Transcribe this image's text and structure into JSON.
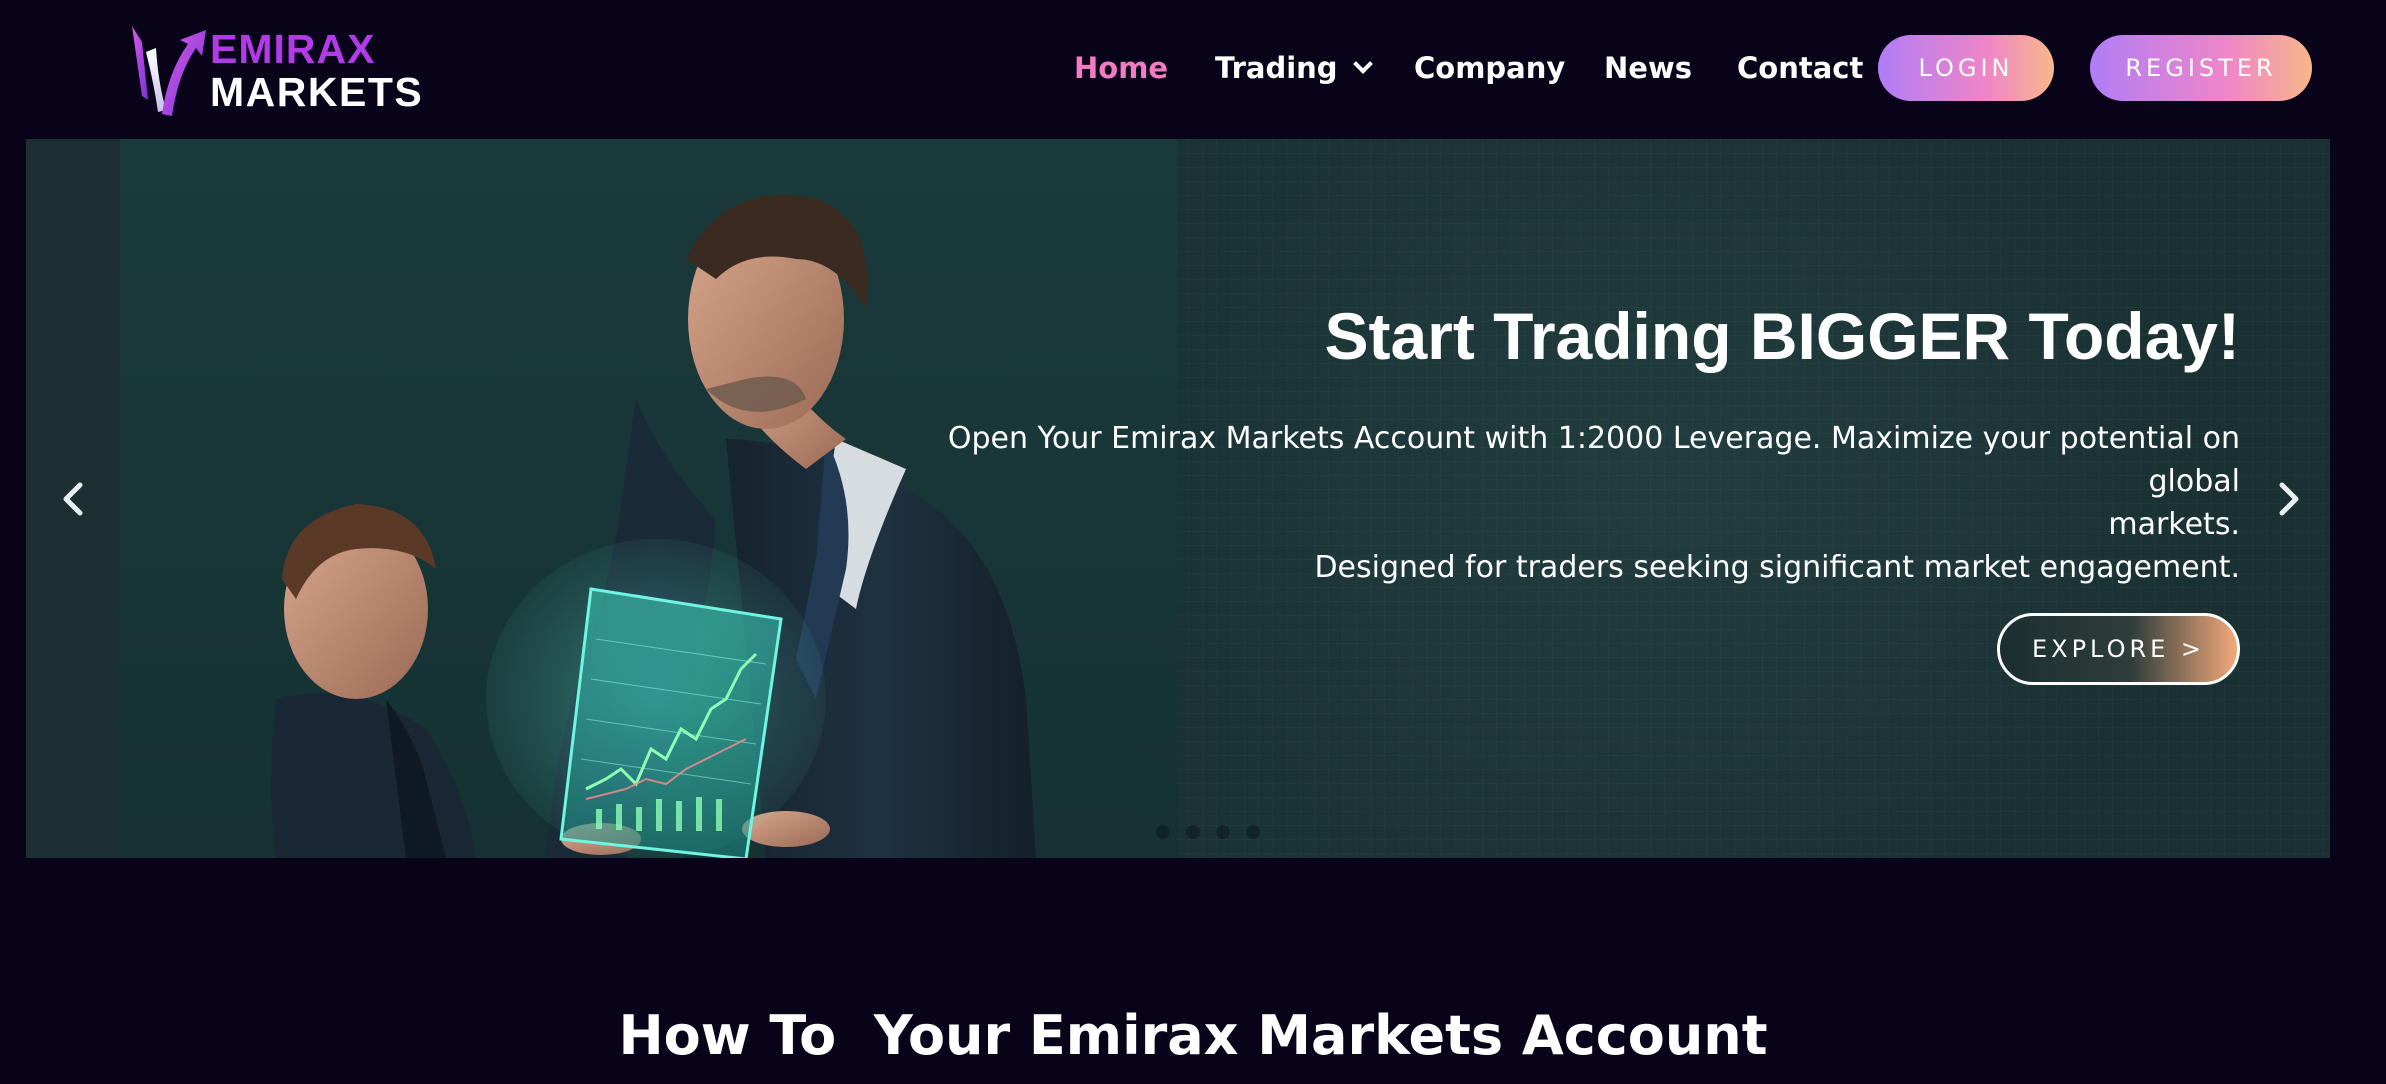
{
  "header": {
    "logo": {
      "line1": "EMIRAX",
      "line2": "MARKETS"
    },
    "nav": [
      {
        "label": "Home",
        "active": true
      },
      {
        "label": "Trading",
        "has_dropdown": true
      },
      {
        "label": "Company"
      },
      {
        "label": "News"
      },
      {
        "label": "Contact"
      }
    ],
    "login_label": "LOGIN",
    "register_label": "REGISTER"
  },
  "hero": {
    "title": "Start Trading BIGGER Today!",
    "subtitle_line1": "Open Your Emirax Markets Account with 1:2000 Leverage. Maximize your potential on global",
    "subtitle_line2": "markets.",
    "subtitle_line3": "Designed for traders seeking significant market engagement.",
    "cta_label": "EXPLORE >",
    "slide_count": 4
  },
  "section": {
    "title": "How To  Your Emirax Markets Account"
  },
  "colors": {
    "background": "#09041a",
    "nav_active": "#f27bc4",
    "logo_accent": "#b23be8",
    "button_gradient_start": "#b07cf6",
    "button_gradient_mid": "#ef86c7",
    "button_gradient_end": "#f8b789"
  },
  "icons": {
    "prev": "chevron-left-icon",
    "next": "chevron-right-icon",
    "dropdown": "chevron-down-icon"
  }
}
